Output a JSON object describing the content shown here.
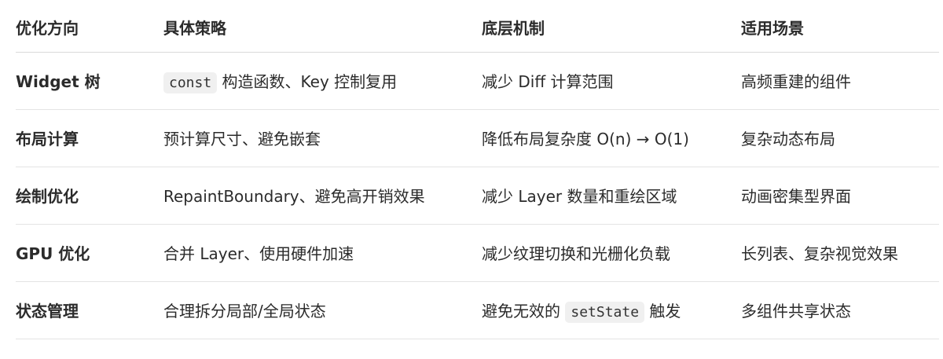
{
  "table": {
    "headers": [
      "优化方向",
      "具体策略",
      "底层机制",
      "适用场景"
    ],
    "rows": [
      {
        "direction": "Widget 树",
        "strategy_code": "const",
        "strategy_text": " 构造函数、Key 控制复用",
        "mechanism_text": "减少 Diff 计算范围",
        "scenario": "高频重建的组件"
      },
      {
        "direction": "布局计算",
        "strategy_text": "预计算尺寸、避免嵌套",
        "mechanism_text": "降低布局复杂度 O(n) → O(1)",
        "scenario": "复杂动态布局"
      },
      {
        "direction": "绘制优化",
        "strategy_text": "RepaintBoundary、避免高开销效果",
        "mechanism_text": "减少 Layer 数量和重绘区域",
        "scenario": "动画密集型界面"
      },
      {
        "direction": "GPU 优化",
        "strategy_text": "合并 Layer、使用硬件加速",
        "mechanism_text": "减少纹理切换和光栅化负载",
        "scenario": "长列表、复杂视觉效果"
      },
      {
        "direction": "状态管理",
        "strategy_text": "合理拆分局部/全局状态",
        "mechanism_prefix": "避免无效的 ",
        "mechanism_code": "setState",
        "mechanism_suffix": " 触发",
        "scenario": "多组件共享状态"
      }
    ]
  }
}
